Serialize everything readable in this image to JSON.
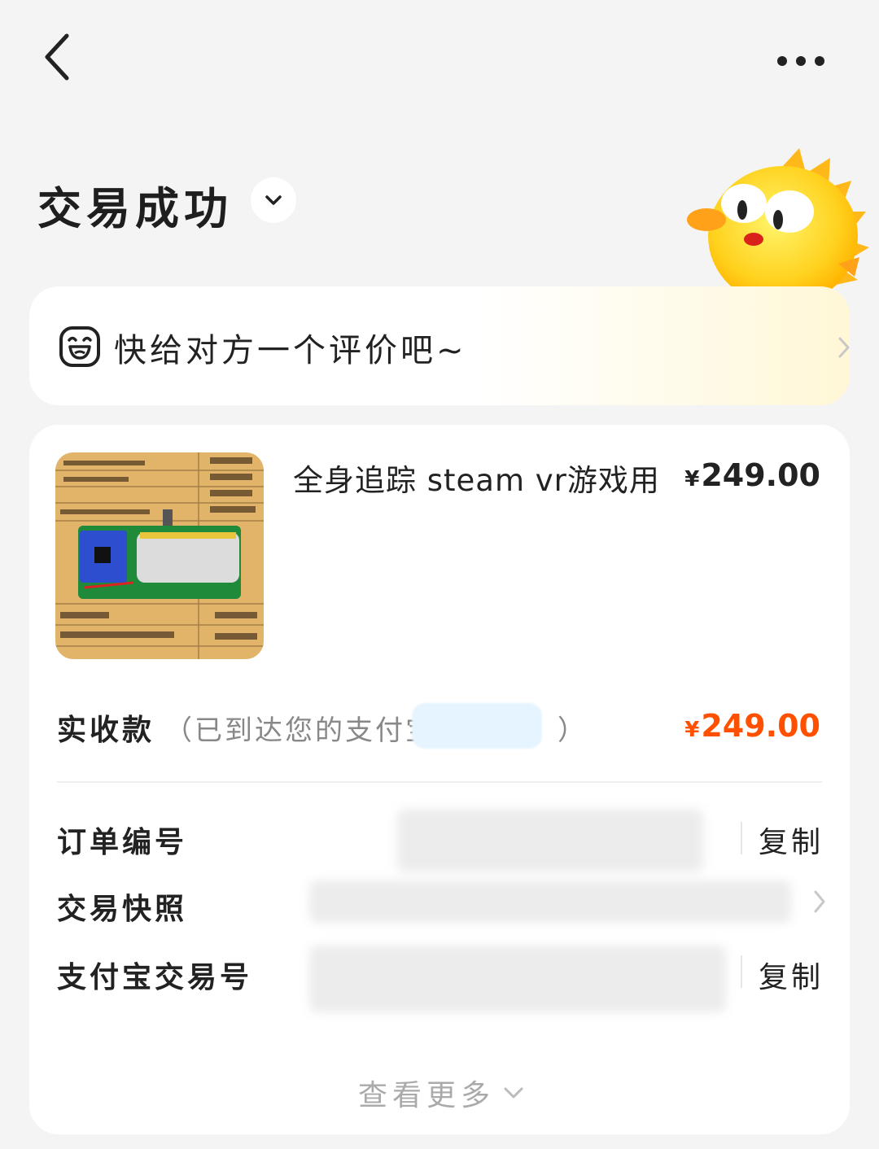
{
  "nav": {
    "back_icon": "chevron-left-icon",
    "more_icon": "more-dots-icon"
  },
  "status": {
    "title": "交易成功",
    "toggle_icon": "chevron-down-icon",
    "mascot": "yellow-fish-mascot"
  },
  "review": {
    "icon": "smiley-face-icon",
    "text": "快给对方一个评价吧~",
    "chevron_icon": "chevron-right-icon"
  },
  "order": {
    "product": {
      "thumbnail": "pcb-with-battery-photo",
      "title": "全身追踪 steam vr游戏用",
      "price_symbol": "¥",
      "price_value": "249.00"
    },
    "received": {
      "label": "实收款",
      "note_open": "（已到达您的支付宝",
      "note_close": "）",
      "amount_symbol": "¥",
      "amount_value": "249.00",
      "amount_color": "#ff5000"
    },
    "details": [
      {
        "label": "订单编号",
        "action": "复制"
      },
      {
        "label": "交易快照",
        "action": ""
      },
      {
        "label": "支付宝交易号",
        "action": "复制"
      }
    ],
    "see_more": "查看更多"
  }
}
